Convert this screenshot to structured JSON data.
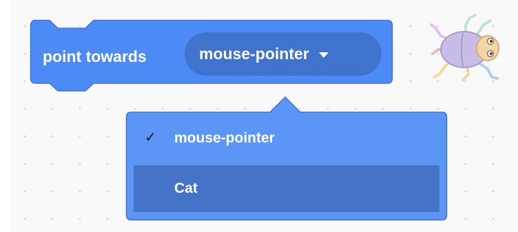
{
  "block": {
    "label": "point towards",
    "selected_value": "mouse-pointer",
    "color": "#4c8bf5",
    "dropdown_color": "#3f73cc"
  },
  "menu": {
    "background": "#5b95f5",
    "hover_color": "#4573c7",
    "check_mark": "✓",
    "items": [
      {
        "label": "mouse-pointer",
        "selected": true
      },
      {
        "label": "Cat",
        "selected": false
      }
    ]
  },
  "sprite": {
    "icon": "beetle-icon"
  }
}
